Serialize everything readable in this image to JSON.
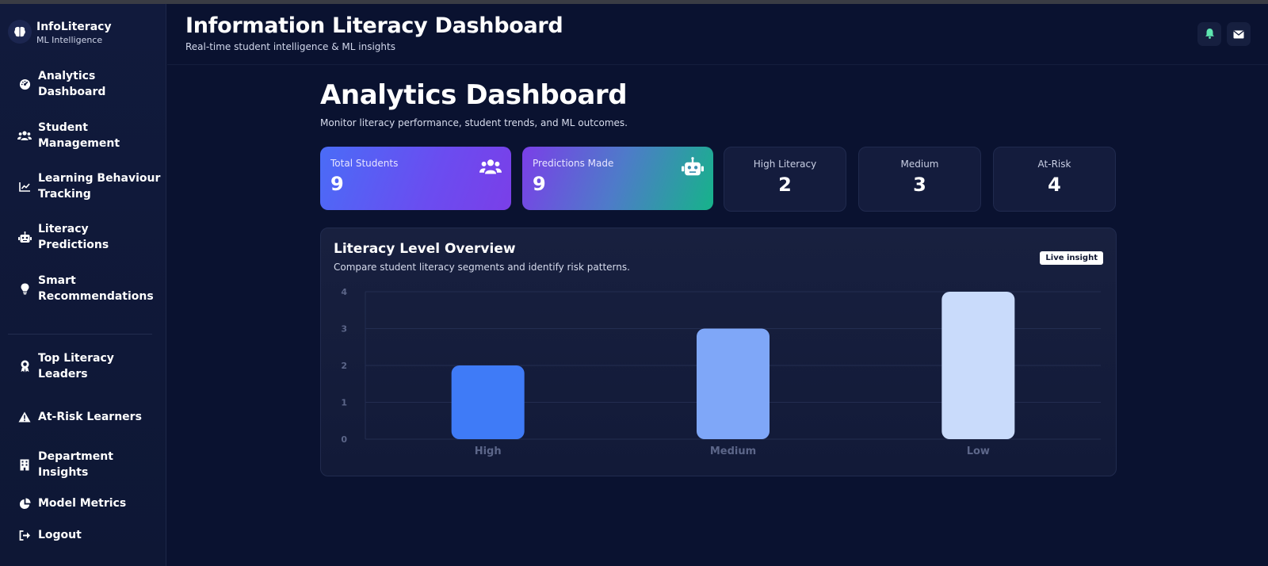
{
  "brand": {
    "title": "InfoLiteracy",
    "subtitle": "ML Intelligence",
    "icon": "brain-icon"
  },
  "sidebar": {
    "items": [
      {
        "label": [
          "Analytics",
          "Dashboard"
        ],
        "icon": "gauge-icon"
      },
      {
        "label": [
          "Student",
          "Management"
        ],
        "icon": "users-icon"
      },
      {
        "label": [
          "Learning Behaviour",
          "Tracking"
        ],
        "icon": "line-chart-icon"
      },
      {
        "label": [
          "Literacy",
          "Predictions"
        ],
        "icon": "robot-icon"
      },
      {
        "label": [
          "Smart",
          "Recommendations"
        ],
        "icon": "lightbulb-icon"
      },
      {
        "label": [
          "Top Literacy",
          "Leaders"
        ],
        "icon": "award-icon"
      },
      {
        "label": [
          "At-Risk Learners"
        ],
        "icon": "warning-icon"
      },
      {
        "label": [
          "Department",
          "Insights"
        ],
        "icon": "building-icon"
      },
      {
        "label": [
          "Model Metrics"
        ],
        "icon": "pie-chart-icon"
      },
      {
        "label": [
          "Logout"
        ],
        "icon": "logout-icon"
      }
    ]
  },
  "header": {
    "title": "Information Literacy Dashboard",
    "subtitle": "Real-time student intelligence & ML insights"
  },
  "main": {
    "title": "Analytics Dashboard",
    "subtitle": "Monitor literacy performance, student trends, and ML outcomes."
  },
  "cards": [
    {
      "label": "Total Students",
      "value": "9",
      "icon": "users-icon"
    },
    {
      "label": "Predictions Made",
      "value": "9",
      "icon": "robot-icon"
    }
  ],
  "stats": [
    {
      "label": "High Literacy",
      "value": "2"
    },
    {
      "label": "Medium",
      "value": "3"
    },
    {
      "label": "At-Risk",
      "value": "4"
    }
  ],
  "panel": {
    "title": "Literacy Level Overview",
    "subtitle": "Compare student literacy segments and identify risk patterns.",
    "badge": "Live insight"
  },
  "colors": {
    "bar_high": "#3f7bf7",
    "bar_medium": "#7fa7f8",
    "bar_low": "#c9dbfb",
    "accent_grad_start": "#4a6cf7",
    "accent_grad_end": "#16b38a"
  },
  "chart_data": {
    "type": "bar",
    "categories": [
      "High",
      "Medium",
      "Low"
    ],
    "values": [
      2,
      3,
      4
    ],
    "ylim": [
      0,
      4
    ],
    "yticks": [
      0,
      1,
      2,
      3,
      4
    ],
    "grid": true
  }
}
